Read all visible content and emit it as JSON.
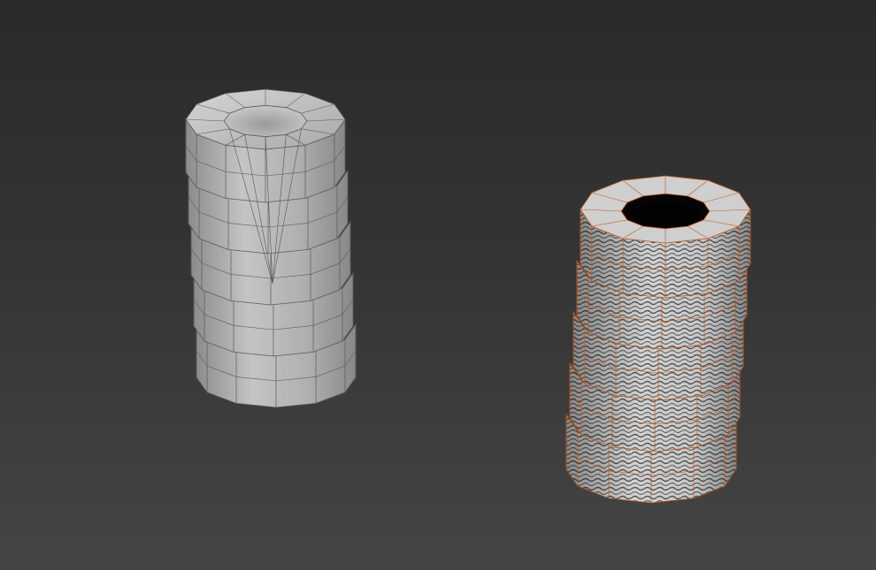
{
  "viewport": {
    "background_top": "#2a2a2a",
    "background_bottom": "#454545"
  },
  "objects": [
    {
      "name": "tire-stack-unselected",
      "shading": "flat-gray",
      "tire_count": 5,
      "wire_color": "#5a5a5a",
      "selected": false
    },
    {
      "name": "tire-stack-selected",
      "shading": "textured-tread",
      "tire_count": 5,
      "wire_color": "#c0581e",
      "selected": true
    }
  ]
}
